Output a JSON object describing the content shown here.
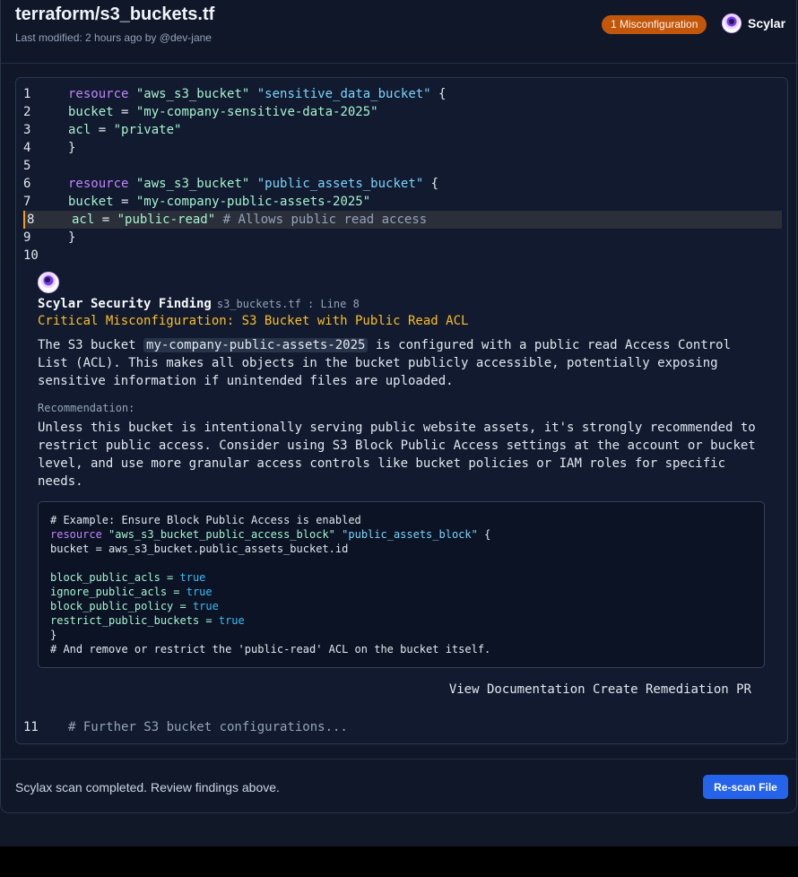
{
  "header": {
    "title": "terraform/s3_buckets.tf",
    "subtitle": "Last modified: 2 hours ago by @dev-jane",
    "badge": "1 Misconfiguration",
    "brand": "Scylar"
  },
  "code_lines": {
    "n1": "1",
    "n2": "2",
    "n3": "3",
    "n4": "4",
    "n5": "5",
    "n6": "6",
    "n7": "7",
    "n8": "8",
    "n9": "9",
    "n10": "10",
    "n11": "11",
    "l1_kw": "resource",
    "l1_s1": "\"aws_s3_bucket\"",
    "l1_s2": "\"sensitive_data_bucket\"",
    "l1_end": " {",
    "l2_attr": "bucket",
    "l2_eq": " = ",
    "l2_val": "\"my-company-sensitive-data-2025\"",
    "l3_attr": "acl",
    "l3_eq": " = ",
    "l3_val": "\"private\"",
    "l4": "}",
    "l6_kw": "resource",
    "l6_s1": "\"aws_s3_bucket\"",
    "l6_s2": "\"public_assets_bucket\"",
    "l6_end": " {",
    "l7_attr": "bucket",
    "l7_eq": " = ",
    "l7_val": "\"my-company-public-assets-2025\"",
    "l8_attr": "acl",
    "l8_eq": " = ",
    "l8_val": "\"public-read\"",
    "l8_cm": " # Allows public read access",
    "l9": "}",
    "l11": "# Further S3 bucket configurations..."
  },
  "finding": {
    "heading": "Scylar Security Finding",
    "file": "s3_buckets.tf",
    "sep": " : ",
    "line": "Line 8",
    "title": "Critical Misconfiguration: S3 Bucket with Public Read ACL",
    "desc_pre": "The S3 bucket ",
    "desc_code": "my-company-public-assets-2025",
    "desc_post": " is configured with a public read Access Control List (ACL). This makes all objects in the bucket publicly accessible, potentially exposing sensitive information if unintended files are uploaded.",
    "rec_label": "Recommendation:",
    "rec_text": "Unless this bucket is intentionally serving public website assets, it's strongly recommended to restrict public access. Consider using S3 Block Public Access settings at the account or bucket level, and use more granular access controls like bucket policies or IAM roles for specific needs.",
    "snippet": {
      "c1": "# Example: Ensure Block Public Access is enabled",
      "kw": "resource",
      "s1": "\"aws_s3_bucket_public_access_block\"",
      "s2": "\"public_assets_block\"",
      "end": " {",
      "b1": "bucket = aws_s3_bucket.public_assets_bucket.id",
      "p1": "block_public_acls = ",
      "v1": "true",
      "p2": "ignore_public_acls = ",
      "v2": "true",
      "p3": "block_public_policy = ",
      "v3": "true",
      "p4": "restrict_public_buckets = ",
      "v4": "true",
      "close": "}",
      "c2": "# And remove or restrict the 'public-read' ACL on the bucket itself."
    },
    "action_docs": "View Documentation",
    "action_pr": "Create Remediation PR"
  },
  "footer": {
    "status": "Scylax scan completed. Review findings above.",
    "rescan": "Re-scan File"
  },
  "colors": {
    "badge": "#c2570c",
    "accent": "#2563eb",
    "warning": "#fbbf24"
  }
}
